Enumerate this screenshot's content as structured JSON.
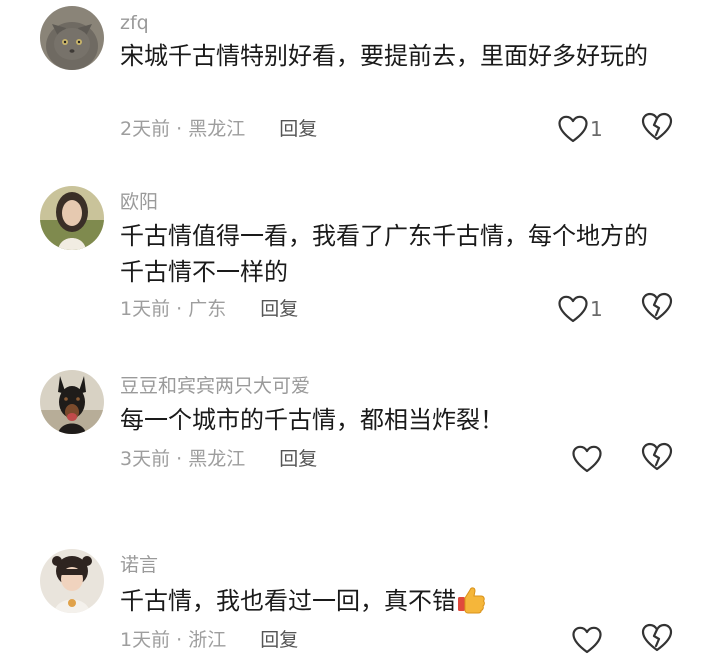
{
  "comments": [
    {
      "username": "zfq",
      "text": "宋城千古情特别好看，要提前去，里面好多好玩的",
      "time": "2天前",
      "location": "黑龙江",
      "reply_label": "回复",
      "likes": "1",
      "avatar": "cat-photo"
    },
    {
      "username": "欧阳",
      "text": "千古情值得一看，我看了广东千古情，每个地方的千古情不一样的",
      "time": "1天前",
      "location": "广东",
      "reply_label": "回复",
      "likes": "1",
      "avatar": "woman-photo"
    },
    {
      "username": "豆豆和宾宾两只大可爱",
      "text": "每一个城市的千古情，都相当炸裂！",
      "time": "3天前",
      "location": "黑龙江",
      "reply_label": "回复",
      "likes": "",
      "avatar": "dog-photo"
    },
    {
      "username": "诺言",
      "text": "千古情，我也看过一回，真不错",
      "text_emoji": "thumbs-up",
      "time": "1天前",
      "location": "浙江",
      "reply_label": "回复",
      "likes": "",
      "avatar": "child-photo"
    }
  ],
  "separator": " · ",
  "icons": {
    "like": "heart-outline-icon",
    "dislike": "broken-heart-outline-icon"
  },
  "colors": {
    "username": "#9a9a9a",
    "text": "#1a1a1a",
    "meta": "#9e9e9e",
    "icon": "#333333"
  }
}
